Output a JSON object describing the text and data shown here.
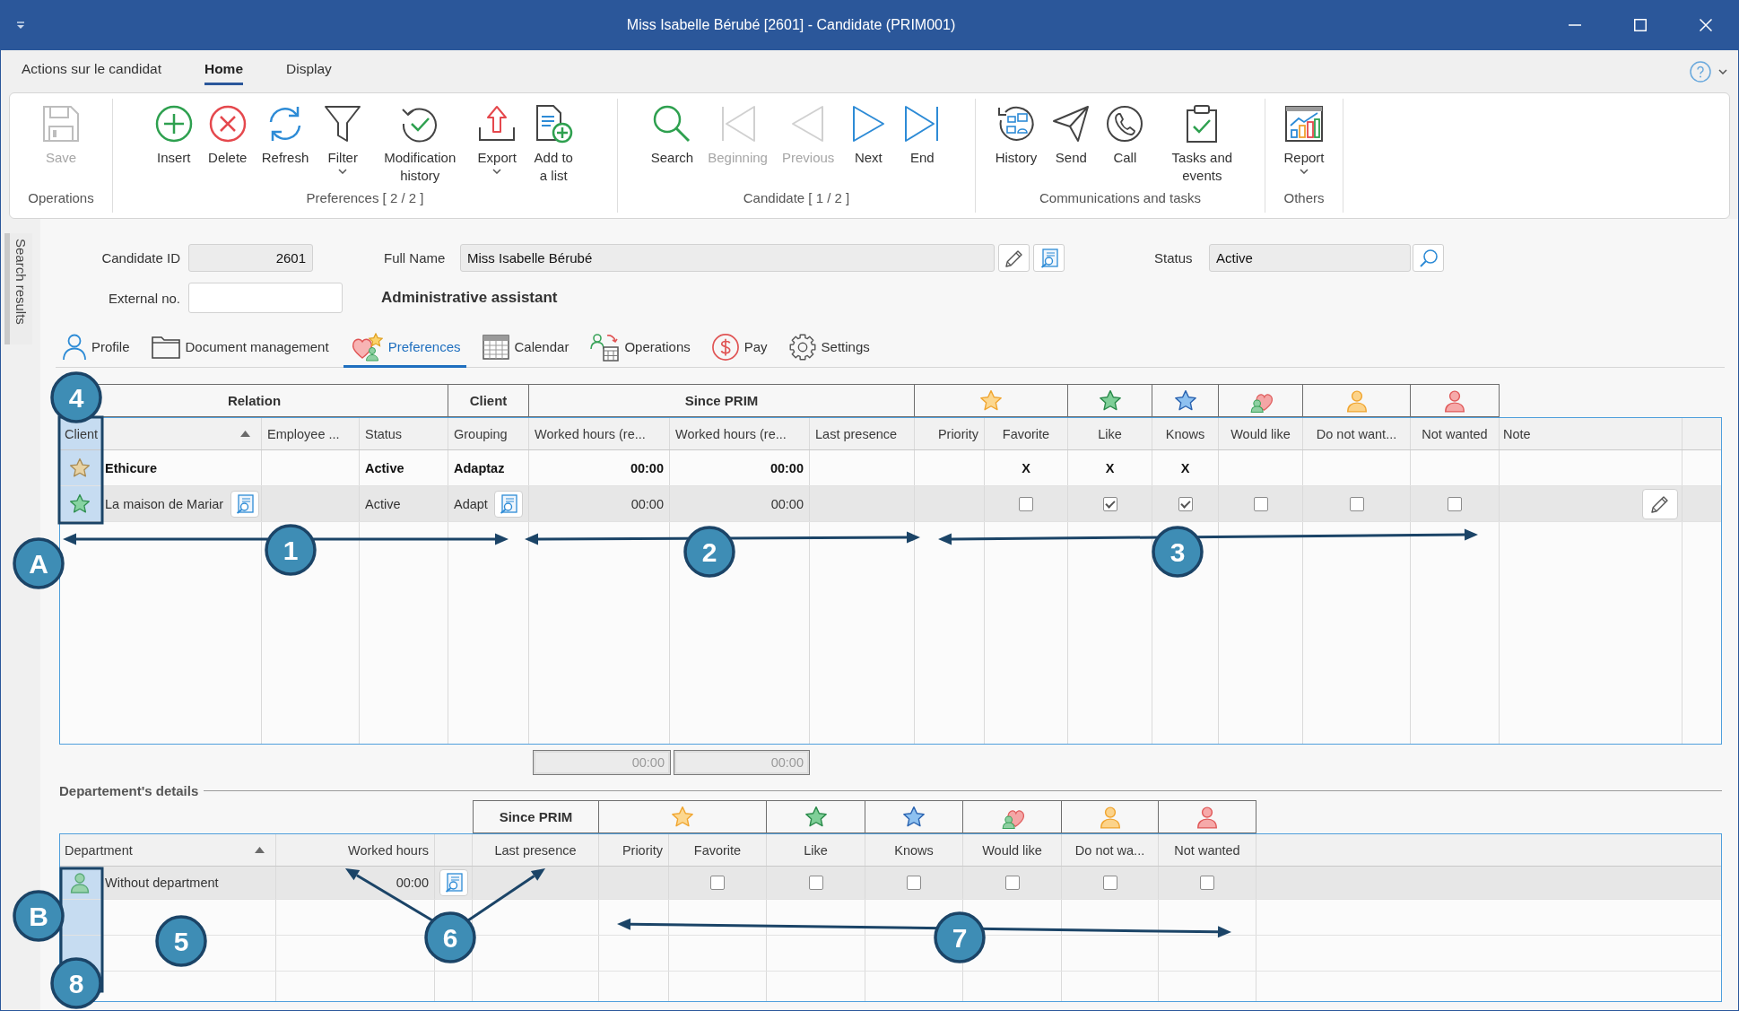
{
  "window": {
    "title": "Miss Isabelle Bérubé [2601] - Candidate (PRIM001)"
  },
  "ribbon_tabs": [
    {
      "label": "Actions sur le candidat",
      "selected": false
    },
    {
      "label": "Home",
      "selected": true
    },
    {
      "label": "Display",
      "selected": false
    }
  ],
  "ribbon": {
    "groups": [
      {
        "label": "Operations",
        "buttons": [
          {
            "kind": "save",
            "label": "Save",
            "disabled": true,
            "dropdown": false
          }
        ]
      },
      {
        "label": "Preferences [ 2 / 2 ]",
        "buttons": [
          {
            "kind": "insert",
            "label": "Insert",
            "disabled": false,
            "dropdown": false
          },
          {
            "kind": "delete",
            "label": "Delete",
            "disabled": false,
            "dropdown": false
          },
          {
            "kind": "refresh",
            "label": "Refresh",
            "disabled": false,
            "dropdown": false
          },
          {
            "kind": "filter",
            "label": "Filter",
            "disabled": false,
            "dropdown": true
          },
          {
            "kind": "history",
            "label": "Modification history",
            "disabled": false,
            "dropdown": false
          },
          {
            "kind": "export",
            "label": "Export",
            "disabled": false,
            "dropdown": true
          },
          {
            "kind": "add_to_list",
            "label": "Add to a list",
            "disabled": false,
            "dropdown": false
          }
        ]
      },
      {
        "label": "Candidate [ 1 / 2 ]",
        "buttons": [
          {
            "kind": "search",
            "label": "Search",
            "disabled": false,
            "dropdown": false
          },
          {
            "kind": "first",
            "label": "Beginning",
            "disabled": true,
            "dropdown": false
          },
          {
            "kind": "previous",
            "label": "Previous",
            "disabled": true,
            "dropdown": false
          },
          {
            "kind": "next",
            "label": "Next",
            "disabled": false,
            "dropdown": false
          },
          {
            "kind": "last",
            "label": "End",
            "disabled": false,
            "dropdown": false
          }
        ]
      },
      {
        "label": "Communications and tasks",
        "buttons": [
          {
            "kind": "contact_history",
            "label": "History",
            "disabled": false,
            "dropdown": false
          },
          {
            "kind": "send",
            "label": "Send",
            "disabled": false,
            "dropdown": false
          },
          {
            "kind": "call",
            "label": "Call",
            "disabled": false,
            "dropdown": false
          },
          {
            "kind": "tasks",
            "label": "Tasks and events",
            "disabled": false,
            "dropdown": false
          }
        ]
      },
      {
        "label": "Others",
        "buttons": [
          {
            "kind": "report",
            "label": "Report",
            "disabled": false,
            "dropdown": true
          }
        ]
      }
    ]
  },
  "sidebar": {
    "tab": "Search results"
  },
  "candidate": {
    "candidate_id": {
      "label": "Candidate ID",
      "value": "2601"
    },
    "full_name": {
      "label": "Full Name",
      "value": "Miss Isabelle Bérubé"
    },
    "status": {
      "label": "Status",
      "value": "Active"
    },
    "external_no": {
      "label": "External no."
    },
    "position": "Administrative assistant"
  },
  "tabs": [
    {
      "kind": "profile",
      "label": "Profile",
      "selected": false
    },
    {
      "kind": "documents",
      "label": "Document management",
      "selected": false
    },
    {
      "kind": "preferences",
      "label": "Preferences",
      "selected": true
    },
    {
      "kind": "calendar",
      "label": "Calendar",
      "selected": false
    },
    {
      "kind": "operations",
      "label": "Operations",
      "selected": false
    },
    {
      "kind": "pay",
      "label": "Pay",
      "selected": false
    },
    {
      "kind": "settings",
      "label": "Settings",
      "selected": false
    }
  ],
  "relations_grid": {
    "bands": [
      {
        "label": "Relation"
      },
      {
        "label": "Client"
      },
      {
        "label": "Since PRIM"
      },
      {
        "kind": "favorite"
      },
      {
        "kind": "like"
      },
      {
        "kind": "knows"
      },
      {
        "kind": "would_like"
      },
      {
        "kind": "do_not_want"
      },
      {
        "kind": "not_wanted"
      }
    ],
    "columns": [
      {
        "label": "Client",
        "sorted": true
      },
      {
        "label": "Employee ...",
        "sorted": false
      },
      {
        "label": "Status",
        "sorted": false
      },
      {
        "label": "Grouping",
        "sorted": false
      },
      {
        "label": "Worked hours (re...",
        "sorted": false
      },
      {
        "label": "Worked hours (re...",
        "sorted": false
      },
      {
        "label": "Last presence",
        "sorted": false
      },
      {
        "label": "Priority",
        "sorted": false
      },
      {
        "label": "Favorite",
        "sorted": false
      },
      {
        "label": "Like",
        "sorted": false
      },
      {
        "label": "Knows",
        "sorted": false
      },
      {
        "label": "Would like",
        "sorted": false
      },
      {
        "label": "Do not want...",
        "sorted": false
      },
      {
        "label": "Not wanted",
        "sorted": false
      },
      {
        "label": "Note",
        "sorted": false
      }
    ],
    "rows": [
      {
        "kind": "favorite",
        "emphasized": true,
        "selected": false,
        "client": "Ethicure",
        "status": "Active",
        "grouping": "Adaptaz",
        "worked_hours_1": "00:00",
        "worked_hours_2": "00:00",
        "favorite": "X",
        "like": "X",
        "knows": "X"
      },
      {
        "kind": "like",
        "emphasized": false,
        "selected": true,
        "client": "La maison de Mariar",
        "status": "Active",
        "grouping": "Adapt",
        "worked_hours_1": "00:00",
        "worked_hours_2": "00:00",
        "favorite": false,
        "like": true,
        "knows": true,
        "would_like": false,
        "do_not_want": false,
        "not_wanted": false
      }
    ],
    "totals": [
      "00:00",
      "00:00"
    ]
  },
  "details": {
    "title": "Departement's details"
  },
  "departments_grid": {
    "bands": [
      {
        "label": "Since PRIM"
      },
      {
        "kind": "favorite"
      },
      {
        "kind": "like"
      },
      {
        "kind": "knows"
      },
      {
        "kind": "would_like"
      },
      {
        "kind": "do_not_want"
      },
      {
        "kind": "not_wanted"
      }
    ],
    "columns": [
      {
        "label": "Department",
        "sorted": true
      },
      {
        "label": "Worked hours",
        "sorted": false
      },
      {
        "label": "Last presence",
        "sorted": false
      },
      {
        "label": "Priority",
        "sorted": false
      },
      {
        "label": "Favorite",
        "sorted": false
      },
      {
        "label": "Like",
        "sorted": false
      },
      {
        "label": "Knows",
        "sorted": false
      },
      {
        "label": "Would like",
        "sorted": false
      },
      {
        "label": "Do not wa...",
        "sorted": false
      },
      {
        "label": "Not wanted",
        "sorted": false
      }
    ],
    "rows": [
      {
        "kind": "person",
        "emphasized": false,
        "selected": true,
        "department": "Without department",
        "worked_hours": "00:00",
        "favorite": false,
        "like": false,
        "knows": false,
        "would_like": false,
        "do_not_want": false,
        "not_wanted": false
      }
    ]
  },
  "callouts": [
    {
      "label": "4"
    },
    {
      "label": "A"
    },
    {
      "label": "1"
    },
    {
      "label": "2"
    },
    {
      "label": "3"
    },
    {
      "label": "B"
    },
    {
      "label": "5"
    },
    {
      "label": "6"
    },
    {
      "label": "7"
    },
    {
      "label": "8"
    }
  ]
}
